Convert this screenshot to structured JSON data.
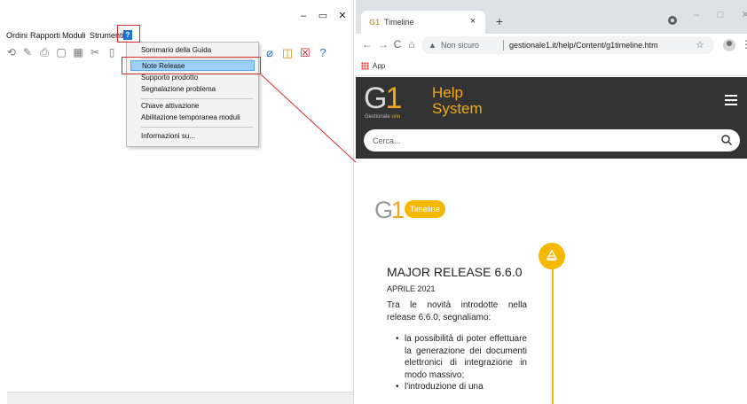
{
  "app": {
    "window_controls": {
      "minimize": "–",
      "maximize": "▭",
      "close": "✕"
    },
    "menu": {
      "ordini": "Ordini",
      "rapporti": "Rapporti",
      "moduli": "Moduli",
      "strumenti": "Strumenti",
      "help_button": "?"
    },
    "help_menu": {
      "items": [
        "Sommario della Guida",
        "Note Release",
        "Supporto prodotto",
        "Segnalazione problema",
        "Chiave attivazione",
        "Abilitazione temporanea moduli",
        "Informazioni su..."
      ],
      "selected": "Note Release"
    },
    "highlight_color": "#d92b2b"
  },
  "browser": {
    "tab": {
      "title": "Timeline",
      "favicon": "G1",
      "close": "×"
    },
    "new_tab": "+",
    "window_controls": {
      "minimize": "–",
      "maximize": "□",
      "close": "✕"
    },
    "nav": {
      "back": "←",
      "forward": "→",
      "reload": "C",
      "home": "⌂"
    },
    "omnibox": {
      "security_icon": "▲",
      "security_text": "Non sicuro",
      "url": "gestionale1.it/help/Content/g1timeline.htm"
    },
    "star": "☆",
    "menu_dots": "⋮",
    "bookmarks": {
      "apps_label": "App"
    }
  },
  "site": {
    "logo": "G1",
    "logo_sub_1": "Gestionale ",
    "logo_sub_2": "uno",
    "title_line_1": "Help",
    "title_line_2": "System",
    "search_placeholder": "Cerca...",
    "accent_color": "#f0a81a",
    "header_bg": "#333333"
  },
  "page": {
    "timeline_logo": "G1",
    "timeline_badge": "Timeline",
    "release": {
      "title": "MAJOR RELEASE 6.6.0",
      "date": "APRILE 2021",
      "intro": "Tra le novità introdotte nella release 6.6.0, segnaliamo:",
      "bullets": [
        "la possibilità di poter effettuare la generazione dei documenti elettronici di integrazione in modo massivo;",
        "l'introduzione di una"
      ]
    }
  }
}
